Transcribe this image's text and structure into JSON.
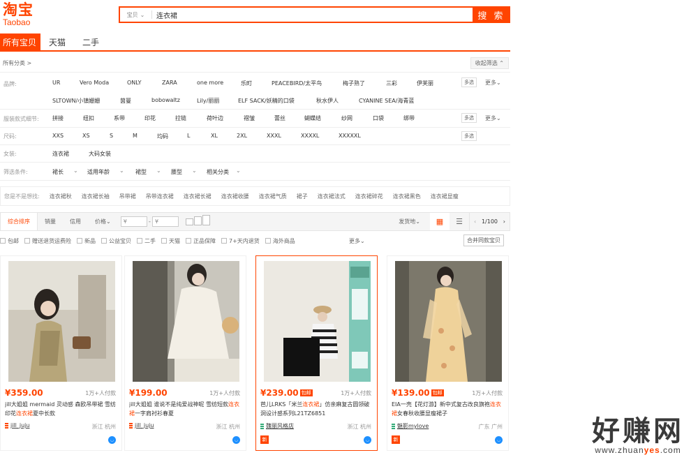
{
  "logo": {
    "cn": "淘宝",
    "en": "Taobao"
  },
  "search": {
    "type": "宝贝",
    "value": "连衣裙",
    "button": "搜 索"
  },
  "tabs": [
    "所有宝贝",
    "天猫",
    "二手"
  ],
  "allcat": {
    "label": "所有分类 >",
    "collapse": "收起筛选"
  },
  "filters": {
    "brand_label": "品牌:",
    "brands_row1": [
      "UR",
      "Vero Moda",
      "ONLY",
      "ZARA",
      "one more",
      "乐町",
      "PEACEBIRD/太平鸟",
      "梅子熟了",
      "三彩",
      "伊芙丽"
    ],
    "brands_row2": [
      "SLTOWN/小镇姗姗",
      "茵曼",
      "bobowaltz",
      "Lily/丽丽",
      "ELF SACK/妖精的口袋",
      "秋水伊人",
      "CYANINE SEA/海青蓝"
    ],
    "multi": "多选",
    "more": "更多",
    "detail_label": "服装款式细节:",
    "details": [
      "拼接",
      "纽扣",
      "系带",
      "印花",
      "拉链",
      "荷叶边",
      "褶皱",
      "蕾丝",
      "蝴蝶结",
      "纱网",
      "口袋",
      "绑带"
    ],
    "size_label": "尺码:",
    "sizes": [
      "XXS",
      "XS",
      "S",
      "M",
      "均码",
      "L",
      "XL",
      "2XL",
      "XXXL",
      "XXXXL",
      "XXXXXL"
    ],
    "women_label": "女装:",
    "women": [
      "连衣裙",
      "大码女装"
    ],
    "cond_label": "筛选条件:",
    "conds": [
      "裙长",
      "适用年龄",
      "裙型",
      "腰型",
      "相关分类"
    ]
  },
  "guess": {
    "label": "您是不是想找:",
    "items": [
      "连衣裙秋",
      "连衣裙长袖",
      "吊带裙",
      "吊带连衣裙",
      "连衣裙长裙",
      "连衣裙收腰",
      "连衣裙气质",
      "裙子",
      "连衣裙法式",
      "连衣裙碎花",
      "连衣裙黑色",
      "连衣裙显瘦"
    ]
  },
  "sort": {
    "items": [
      "综合排序",
      "销量",
      "信用",
      "价格"
    ],
    "price_ph": "¥",
    "dash": "-",
    "ship": "发货地",
    "page": "1/100"
  },
  "checks": [
    "包邮",
    "赠送退货运费险",
    "新品",
    "公益宝贝",
    "二手",
    "天猫",
    "正品保障",
    "7+天内退货",
    "海外商品"
  ],
  "checks_more": "更多",
  "merge": "合并同款宝贝",
  "products": [
    {
      "price": "¥359.00",
      "deal": "1万+人付款",
      "title_a": "jill大姐姐 mermaid 灵动感 森欧吊带裙 雪纺印花",
      "title_hi": "连衣裙",
      "title_b": "夏中长款",
      "shop": "jill_juju",
      "loc": "浙江 杭州",
      "badge": ""
    },
    {
      "price": "¥199.00",
      "deal": "1万+人付款",
      "title_a": "jill大姐姐 谁说不是纯爱战神呢 雪纺短款",
      "title_hi": "连衣裙",
      "title_b": "一字肩衬衫春夏",
      "shop": "jill_juju",
      "loc": "浙江 杭州",
      "badge": ""
    },
    {
      "price": "¥239.00",
      "baoyou": "包邮",
      "deal": "1万+人付款",
      "title_a": "芭儿LRKS「米兰",
      "title_hi": "连衣裙",
      "title_b": "」仿亲麻复古圆领破洞设计感系列L21TZ6851",
      "shop": "魏丽风格店",
      "loc": "浙江 杭州",
      "badge": "新"
    },
    {
      "price": "¥139.00",
      "baoyou": "包邮",
      "deal": "1万+人付款",
      "title_a": "EIA一壳【花灯游】新中式复古改良旗袍",
      "title_hi": "连衣裙",
      "title_b": "女春秋收腰显瘦裙子",
      "shop": "魅影mylove",
      "loc": "广东 广州",
      "badge": "新"
    }
  ],
  "watermark": {
    "big": "好赚网",
    "small_a": "www.zhuan",
    "small_b": "yes",
    "small_c": ".com"
  },
  "colors": {
    "accent": "#ff4400"
  }
}
